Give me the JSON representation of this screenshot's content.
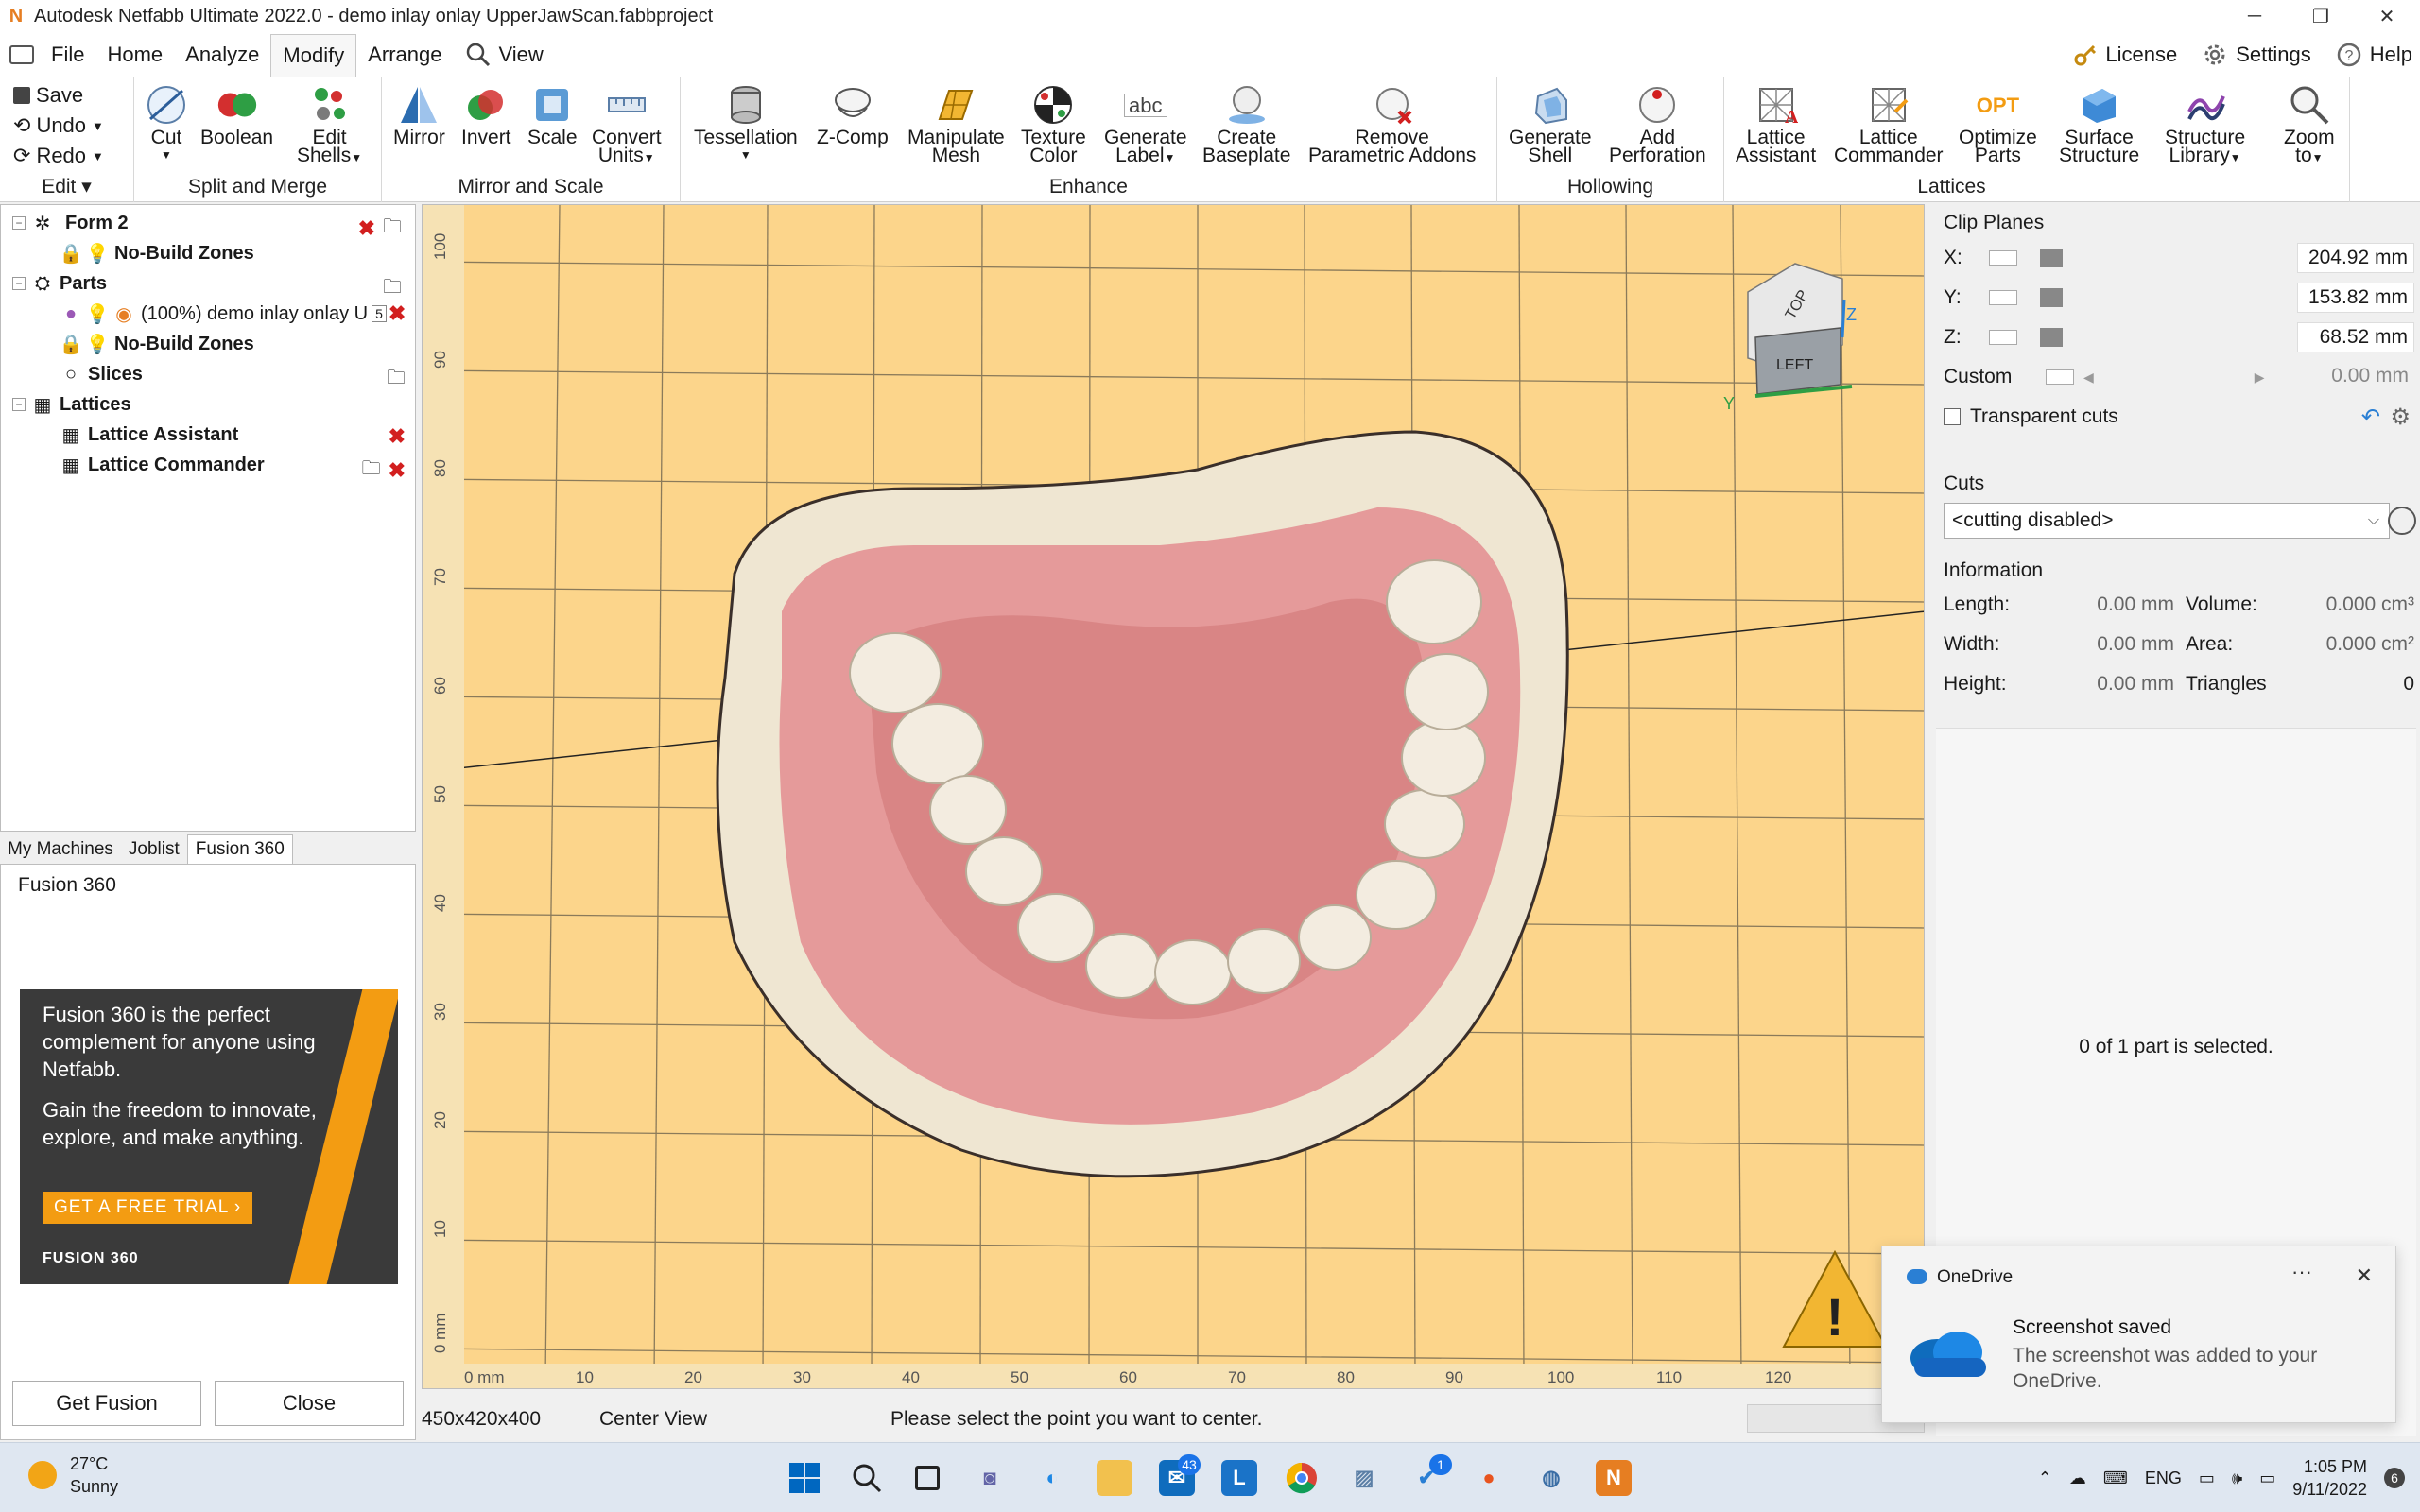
{
  "window": {
    "title": "Autodesk Netfabb Ultimate 2022.0 - demo inlay onlay UpperJawScan.fabbproject",
    "minimize": "─",
    "maximize": "❐",
    "close": "✕"
  },
  "menu": {
    "items": [
      "File",
      "Home",
      "Analyze",
      "Modify",
      "Arrange",
      "View"
    ],
    "active": "Modify",
    "right": [
      "License",
      "Settings",
      "Help"
    ]
  },
  "ribbon": {
    "edit": {
      "save": "Save",
      "undo": "Undo",
      "redo": "Redo",
      "label": "Edit"
    },
    "split_merge": {
      "label": "Split and Merge",
      "buttons": [
        "Cut",
        "Boolean",
        "Edit",
        "Shells"
      ]
    },
    "mirror_scale": {
      "label": "Mirror and Scale",
      "buttons": [
        "Mirror",
        "Invert",
        "Scale",
        "Convert",
        "Units"
      ]
    },
    "enhance": {
      "label": "Enhance",
      "buttons": [
        "Tessellation",
        "Z-Comp",
        "Manipulate",
        "Mesh",
        "Texture",
        "Color",
        "Generate",
        "Label",
        "Create",
        "Baseplate",
        "Remove",
        "Parametric Addons"
      ]
    },
    "hollowing": {
      "label": "Hollowing",
      "buttons": [
        "Generate",
        "Shell",
        "Add",
        "Perforation"
      ]
    },
    "lattices": {
      "label": "Lattices",
      "buttons": [
        "Lattice",
        "Assistant",
        "Lattice",
        "Commander",
        "Optimize",
        "Parts",
        "Surface",
        "Structure",
        "Structure",
        "Library",
        "Zoom",
        "to"
      ]
    },
    "opt_badge": "OPT",
    "abc_badge": "abc"
  },
  "tree": {
    "form": "Form 2",
    "no_build_1": "No-Build Zones",
    "parts": "Parts",
    "part_name": "(100%) demo inlay onlay U",
    "part_badge": "5",
    "no_build_2": "No-Build Zones",
    "slices": "Slices",
    "lattices": "Lattices",
    "lattice_assistant": "Lattice Assistant",
    "lattice_commander": "Lattice Commander"
  },
  "side_tabs": [
    "My Machines",
    "Joblist",
    "Fusion 360"
  ],
  "fusion": {
    "title": "Fusion 360",
    "ad_line1": "Fusion 360 is the perfect complement for anyone using Netfabb.",
    "ad_line2": "Gain the freedom to innovate, explore, and make anything.",
    "cta": "GET A FREE TRIAL  ›",
    "brand": "FUSION 360",
    "get": "Get Fusion",
    "close": "Close"
  },
  "viewport": {
    "ruler_x": [
      "0 mm",
      "10",
      "20",
      "30",
      "40",
      "50",
      "60",
      "70",
      "80",
      "90",
      "100",
      "110",
      "120"
    ],
    "ruler_y": [
      "100",
      "90",
      "80",
      "70",
      "60",
      "50",
      "40",
      "30",
      "20",
      "10",
      "0 mm"
    ],
    "cube_top": "TOP",
    "cube_left": "LEFT",
    "axis_y": "Y",
    "axis_z": "Z",
    "warning": "!"
  },
  "clip_planes": {
    "title": "Clip Planes",
    "x_label": "X:",
    "x": "204.92 mm",
    "y_label": "Y:",
    "y": "153.82 mm",
    "z_label": "Z:",
    "z": "68.52 mm",
    "custom_label": "Custom",
    "custom": "0.00 mm",
    "transparent": "Transparent cuts"
  },
  "cuts": {
    "title": "Cuts",
    "value": "<cutting disabled>"
  },
  "information": {
    "title": "Information",
    "length_label": "Length:",
    "length": "0.00 mm",
    "width_label": "Width:",
    "width": "0.00 mm",
    "height_label": "Height:",
    "height": "0.00 mm",
    "volume_label": "Volume:",
    "volume": "0.000 cm³",
    "area_label": "Area:",
    "area": "0.000 cm²",
    "triangles_label": "Triangles",
    "triangles": "0"
  },
  "selection": "0 of 1 part is selected.",
  "status": {
    "dims": "450x420x400",
    "mode": "Center View",
    "hint": "Please select the point you want to center."
  },
  "toast": {
    "app": "OneDrive",
    "more": "···",
    "close": "✕",
    "title": "Screenshot saved",
    "body": "The screenshot was added to your OneDrive."
  },
  "taskbar": {
    "temp": "27°C",
    "condition": "Sunny",
    "mail_badge": "43",
    "todo_badge": "1",
    "lang": "ENG",
    "time": "1:05 PM",
    "date": "9/11/2022",
    "notif": "6"
  },
  "colors": {
    "viewport_bg": "#fcd58b",
    "accent": "#0067c0",
    "delete": "#d21f1f",
    "fusion_orange": "#f39c12"
  }
}
